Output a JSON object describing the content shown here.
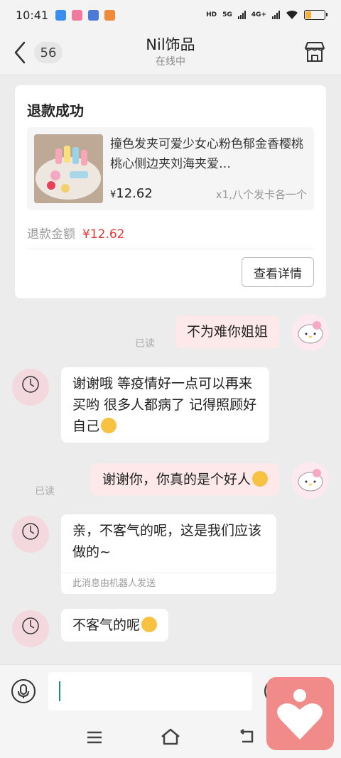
{
  "status_bar": {
    "time": "10:41",
    "network_labels": [
      "HD",
      "5G",
      "4G+"
    ],
    "battery_level": 0.3
  },
  "header": {
    "unread_count": "56",
    "shop_name": "Nil饰品",
    "shop_status": "在线中",
    "icons": {
      "back": "chevron-left-icon",
      "store": "store-icon"
    }
  },
  "refund_card": {
    "title": "退款成功",
    "product_name": "撞色发夹可爱少女心粉色郁金香樱桃桃心侧边夹刘海夹爱…",
    "currency": "¥",
    "price": "12.62",
    "quantity": "x1,八个发卡各一个",
    "amount_label": "退款金额",
    "amount_value": "¥12.62",
    "detail_button": "查看详情"
  },
  "messages": [
    {
      "side": "mine",
      "text": "不为难你姐姐",
      "read_label": "已读"
    },
    {
      "side": "theirs",
      "text": "谢谢哦 等疫情好一点可以再来买哟 很多人都病了 记得照顾好自己",
      "emoji": "hug-emoji"
    },
    {
      "side": "mine",
      "text": "谢谢你，你真的是个好人",
      "emoji": "heart-eyes-emoji",
      "read_label": "已读"
    },
    {
      "side": "theirs",
      "text": "亲，不客气的呢，这是我们应该做的~",
      "note": "此消息由机器人发送"
    },
    {
      "side": "theirs",
      "text": "不客气的呢",
      "emoji": "hug-emoji"
    }
  ],
  "input_bar": {
    "placeholder": "",
    "icons": {
      "voice": "microphone-icon",
      "emoji": "emoji-icon",
      "more": "plus-icon"
    }
  },
  "nav_bar": {
    "icons": {
      "menu": "menu-icon",
      "home": "home-icon",
      "back": "back-icon"
    }
  },
  "floating_button": {
    "icon": "heart-person-icon"
  },
  "colors": {
    "accent_teal": "#1a8f80",
    "price_red": "#e53a3a",
    "my_bubble": "#fde9ea",
    "float_button": "#f08b8a"
  }
}
